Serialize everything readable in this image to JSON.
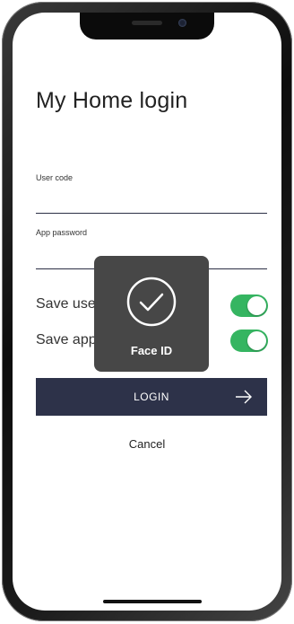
{
  "screen": {
    "title": "My Home login"
  },
  "form": {
    "user_code_label": "User code",
    "user_code_value": "",
    "app_password_label": "App password",
    "app_password_value": ""
  },
  "toggles": [
    {
      "label": "Save user code",
      "on": true
    },
    {
      "label": "Save app password",
      "on": true
    }
  ],
  "login_button": {
    "label": "LOGIN",
    "icon": "arrow-right-icon"
  },
  "cancel_label": "Cancel",
  "face_id": {
    "label": "Face ID",
    "icon": "checkmark-circle-icon"
  },
  "colors": {
    "accent_dark": "#2d3249",
    "toggle_on": "#35b561",
    "overlay": "#474747"
  }
}
